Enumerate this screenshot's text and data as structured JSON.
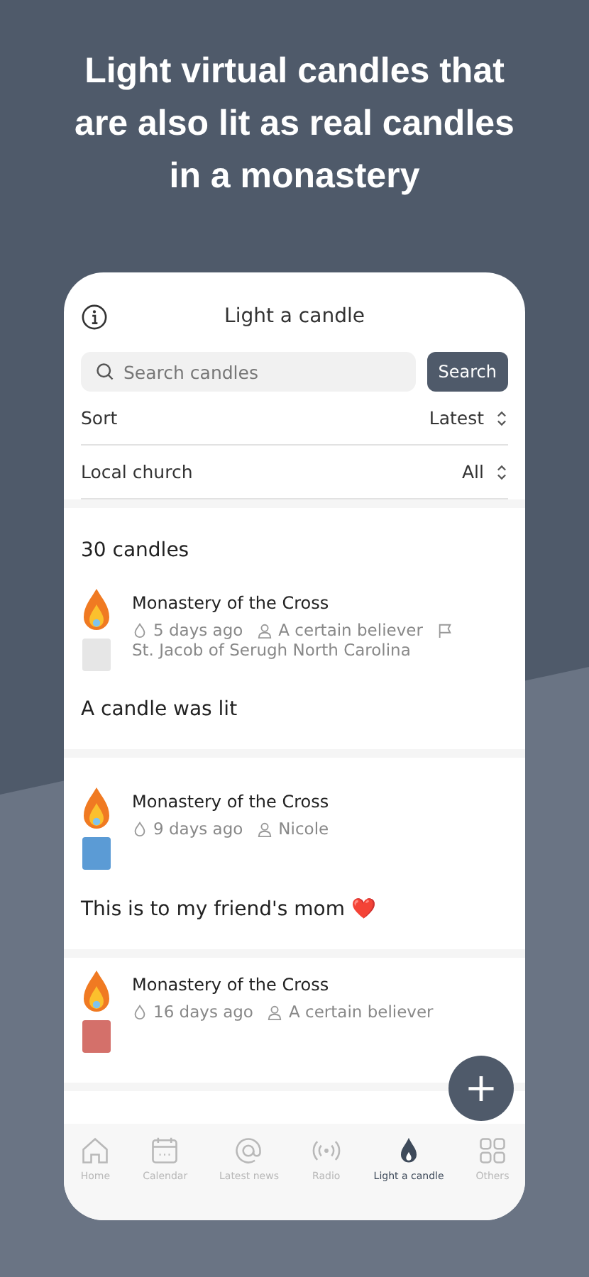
{
  "headline": "Light virtual candles that are also lit as real candles in a monastery",
  "header": {
    "title": "Light a candle"
  },
  "search": {
    "placeholder": "Search candles",
    "button": "Search"
  },
  "filters": [
    {
      "label": "Sort",
      "value": "Latest"
    },
    {
      "label": "Local church",
      "value": "All"
    }
  ],
  "count": "30 candles",
  "candles": [
    {
      "place": "Monastery of the Cross",
      "time": "5 days ago",
      "author": "A certain believer",
      "church": "St. Jacob of Serugh North Carolina",
      "message": "A candle was lit",
      "color": "#e6e6e6"
    },
    {
      "place": "Monastery of the Cross",
      "time": "9 days ago",
      "author": "Nicole",
      "message": "This is to my friend's mom ❤️",
      "color": "#5b9bd5"
    },
    {
      "place": "Monastery of the Cross",
      "time": "16 days ago",
      "author": "A certain believer",
      "color": "#d4706a"
    }
  ],
  "fab": "+",
  "nav": [
    {
      "label": "Home",
      "selected": false
    },
    {
      "label": "Calendar",
      "selected": false
    },
    {
      "label": "Latest news",
      "selected": false
    },
    {
      "label": "Radio",
      "selected": false
    },
    {
      "label": "Light a candle",
      "selected": true
    },
    {
      "label": "Others",
      "selected": false
    }
  ]
}
